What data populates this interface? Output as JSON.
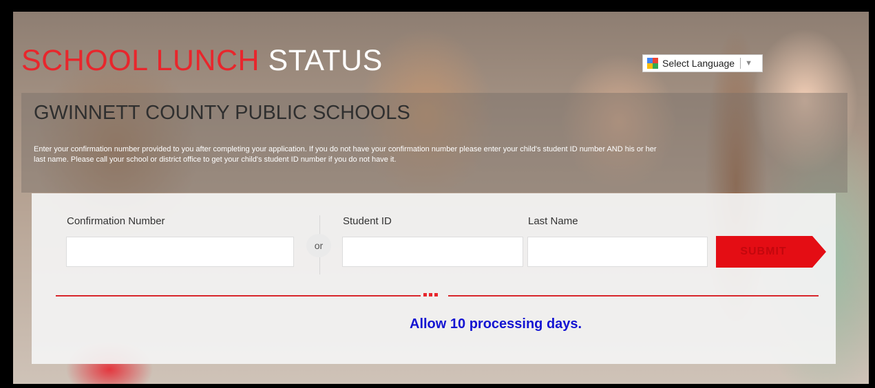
{
  "header": {
    "title_red": "SCHOOL LUNCH",
    "title_white": "STATUS",
    "language_selector": "Select Language"
  },
  "district_name": "GWINNETT COUNTY PUBLIC SCHOOLS",
  "instructions": "Enter your confirmation number provided to you after completing your application. If you do not have your confirmation number please enter your child's student ID number AND his or her last name. Please call your school or district office to get your child's student ID number if you do not have it.",
  "form": {
    "confirmation_label": "Confirmation Number",
    "confirmation_value": "",
    "or_label": "or",
    "student_id_label": "Student ID",
    "student_id_value": "",
    "last_name_label": "Last Name",
    "last_name_value": "",
    "submit_label": "SUBMIT"
  },
  "notice": "Allow 10 processing days.",
  "colors": {
    "title_red": "#e8262c",
    "submit_red": "#e40d14",
    "notice_blue": "#1414d2"
  }
}
